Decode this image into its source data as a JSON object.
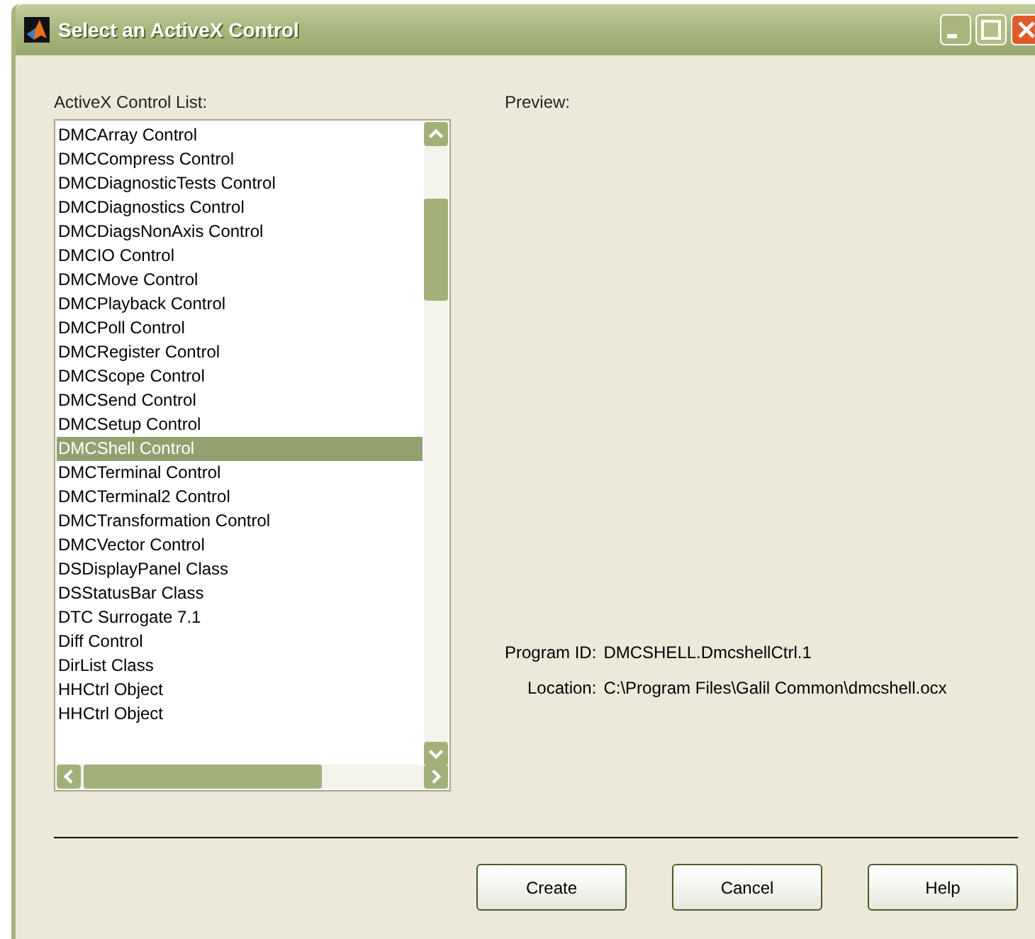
{
  "window": {
    "title": "Select an ActiveX Control"
  },
  "list": {
    "label": "ActiveX Control List:",
    "items": [
      {
        "text": "DMCArray Control",
        "selected": false
      },
      {
        "text": "DMCCompress Control",
        "selected": false
      },
      {
        "text": "DMCDiagnosticTests Control",
        "selected": false
      },
      {
        "text": "DMCDiagnostics Control",
        "selected": false
      },
      {
        "text": "DMCDiagsNonAxis Control",
        "selected": false
      },
      {
        "text": "DMCIO Control",
        "selected": false
      },
      {
        "text": "DMCMove Control",
        "selected": false
      },
      {
        "text": "DMCPlayback Control",
        "selected": false
      },
      {
        "text": "DMCPoll Control",
        "selected": false
      },
      {
        "text": "DMCRegister Control",
        "selected": false
      },
      {
        "text": "DMCScope Control",
        "selected": false
      },
      {
        "text": "DMCSend Control",
        "selected": false
      },
      {
        "text": "DMCSetup Control",
        "selected": false
      },
      {
        "text": "DMCShell Control",
        "selected": true
      },
      {
        "text": "DMCTerminal Control",
        "selected": false
      },
      {
        "text": "DMCTerminal2 Control",
        "selected": false
      },
      {
        "text": "DMCTransformation Control",
        "selected": false
      },
      {
        "text": "DMCVector Control",
        "selected": false
      },
      {
        "text": "DSDisplayPanel Class",
        "selected": false
      },
      {
        "text": "DSStatusBar Class",
        "selected": false
      },
      {
        "text": "DTC Surrogate 7.1",
        "selected": false
      },
      {
        "text": "Diff Control",
        "selected": false
      },
      {
        "text": "DirList Class",
        "selected": false
      },
      {
        "text": "HHCtrl Object",
        "selected": false
      },
      {
        "text": "HHCtrl Object",
        "selected": false
      }
    ]
  },
  "preview": {
    "label": "Preview:"
  },
  "details": [
    {
      "label": "Program ID:",
      "value": "DMCSHELL.DmcshellCtrl.1"
    },
    {
      "label": "Location:",
      "value": "C:\\Program Files\\Galil Common\\dmcshell.ocx"
    }
  ],
  "buttons": [
    "Create",
    "Cancel",
    "Help"
  ]
}
